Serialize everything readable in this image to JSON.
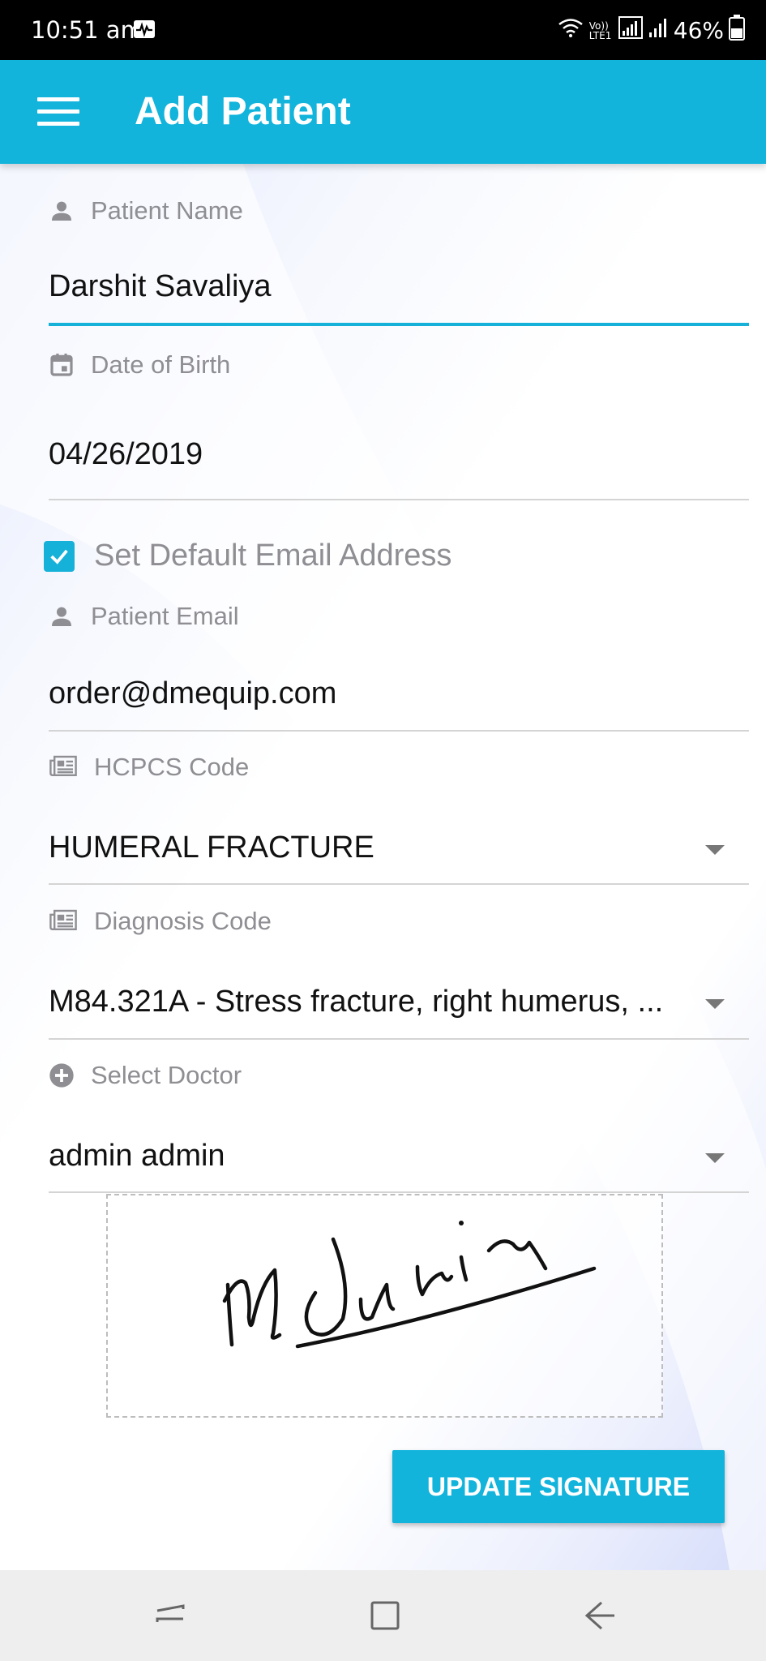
{
  "status_bar": {
    "time": "10:51 am",
    "battery": "46%",
    "lte_label": "Vo)) LTE1"
  },
  "app_bar": {
    "title": "Add Patient"
  },
  "form": {
    "patient_name": {
      "label": "Patient Name",
      "value": "Darshit Savaliya"
    },
    "date_of_birth": {
      "label": "Date of Birth",
      "value": "04/26/2019"
    },
    "default_email_checkbox": {
      "label": "Set Default Email Address",
      "checked": true
    },
    "patient_email": {
      "label": "Patient Email",
      "value": "order@dmequip.com"
    },
    "hcpcs_code": {
      "label": "HCPCS Code",
      "value": "HUMERAL FRACTURE"
    },
    "diagnosis_code": {
      "label": "Diagnosis Code",
      "value": "M84.321A - Stress fracture, right humerus, ..."
    },
    "doctor": {
      "label": "Select Doctor",
      "value": "admin admin"
    }
  },
  "signature": {
    "button_label": "UPDATE SIGNATURE"
  },
  "colors": {
    "primary": "#12b4dc",
    "label_gray": "#8e8e93",
    "underline": "#d4d4d4"
  },
  "icons": {
    "patient_name": "person-icon",
    "date_of_birth": "calendar-icon",
    "patient_email": "person-icon",
    "hcpcs_code": "newspaper-icon",
    "diagnosis_code": "newspaper-icon",
    "doctor": "add-circle-icon"
  }
}
